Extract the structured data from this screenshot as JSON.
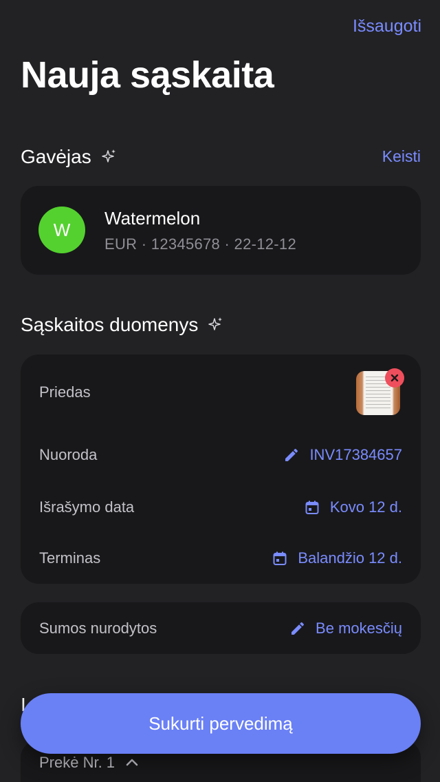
{
  "header": {
    "save_label": "Išsaugoti",
    "title": "Nauja sąskaita"
  },
  "recipient_section": {
    "title": "Gavėjas",
    "change_label": "Keisti",
    "avatar_letter": "W",
    "avatar_color": "#54d12f",
    "name": "Watermelon",
    "details": "EUR · 12345678 · 22-12-12"
  },
  "invoice_section": {
    "title": "Sąskaitos duomenys",
    "attachment_label": "Priedas",
    "reference_label": "Nuoroda",
    "reference_value": "INV17384657",
    "issue_date_label": "Išrašymo data",
    "issue_date_value": "Kovo 12 d.",
    "due_label": "Terminas",
    "due_value": "Balandžio 12 d.",
    "amounts_label": "Sumos nurodytos",
    "amounts_value": "Be mokesčių"
  },
  "items_section": {
    "title": "I",
    "item_label": "Prekė Nr. 1"
  },
  "footer": {
    "create_label": "Sukurti pervedimą"
  },
  "colors": {
    "accent": "#7a8cff",
    "button": "#6a80f5",
    "remove": "#ef4e5c"
  },
  "icons": [
    "sparkle-icon",
    "pencil-icon",
    "calendar-icon",
    "close-icon",
    "chevron-up-icon"
  ]
}
